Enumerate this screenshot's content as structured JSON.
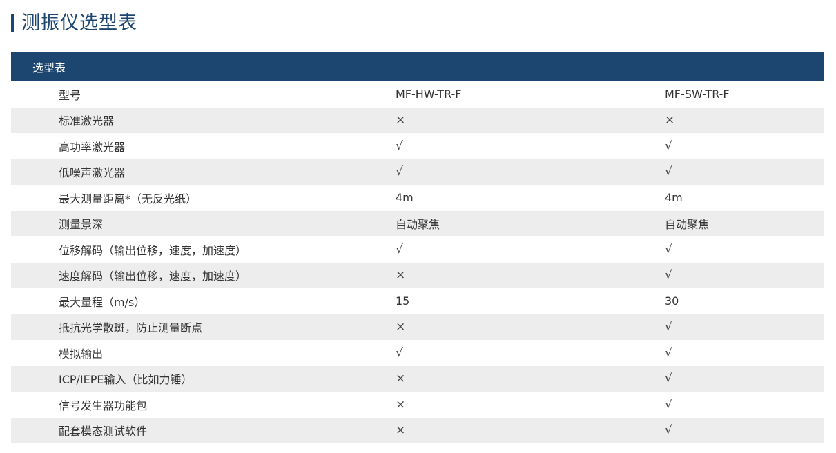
{
  "page": {
    "title": "测振仪选型表"
  },
  "table": {
    "header_label": "选型表",
    "rows": [
      {
        "label": "型号",
        "a": "MF-HW-TR-F",
        "b": "MF-SW-TR-F"
      },
      {
        "label": "标准激光器",
        "a": "×",
        "b": "×"
      },
      {
        "label": "高功率激光器",
        "a": "√",
        "b": "√"
      },
      {
        "label": "低噪声激光器",
        "a": "√",
        "b": "√"
      },
      {
        "label": "最大测量距离*（无反光纸）",
        "a": "4m",
        "b": "4m"
      },
      {
        "label": "测量景深",
        "a": "自动聚焦",
        "b": "自动聚焦"
      },
      {
        "label": "位移解码（输出位移，速度，加速度）",
        "a": "√",
        "b": "√"
      },
      {
        "label": "速度解码（输出位移，速度，加速度）",
        "a": "×",
        "b": "√"
      },
      {
        "label": "最大量程（m/s）",
        "a": "15",
        "b": "30"
      },
      {
        "label": "抵抗光学散斑，防止测量断点",
        "a": "×",
        "b": "√"
      },
      {
        "label": "模拟输出",
        "a": "√",
        "b": "√"
      },
      {
        "label": "ICP/IEPE输入（比如力锤）",
        "a": "×",
        "b": "√"
      },
      {
        "label": "信号发生器功能包",
        "a": "×",
        "b": "√"
      },
      {
        "label": "配套模态测试软件",
        "a": "×",
        "b": "√"
      }
    ]
  },
  "colors": {
    "accent": "#1c4570",
    "stripe": "#ededed"
  }
}
